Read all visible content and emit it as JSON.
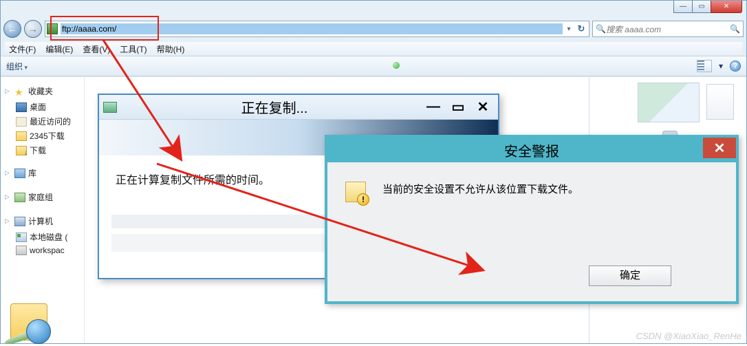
{
  "window": {
    "caption_min": "—",
    "caption_max": "▭",
    "caption_close": "✕"
  },
  "nav": {
    "back_glyph": "←",
    "fwd_glyph": "→",
    "address_url": "ftp://aaaa.com/",
    "dropdown_glyph": "▾",
    "refresh_glyph": "↻",
    "search_placeholder": "搜索 aaaa.com",
    "search_icon": "🔍"
  },
  "menu": {
    "file": "文件(F)",
    "edit": "编辑(E)",
    "view": "查看(V)",
    "tools": "工具(T)",
    "help": "帮助(H)"
  },
  "toolbar": {
    "organize": "组织",
    "view_drop": "▾",
    "help": "?"
  },
  "sidebar": {
    "fav_title": "收藏夹",
    "desktop": "桌面",
    "recent": "最近访问的",
    "folder_2345": "2345下载",
    "downloads": "下载",
    "library": "库",
    "homegroup": "家庭组",
    "computer": "计算机",
    "drive_local": "本地磁盘 (",
    "drive_work": "workspac"
  },
  "copy_dialog": {
    "title": "正在复制...",
    "min": "—",
    "max": "▭",
    "close": "✕",
    "message": "正在计算复制文件所需的时间。"
  },
  "security_dialog": {
    "title": "安全警报",
    "close": "✕",
    "message": "当前的安全设置不允许从该位置下载文件。",
    "ok": "确定"
  },
  "watermark": "CSDN @XiaoXiao_RenHe"
}
